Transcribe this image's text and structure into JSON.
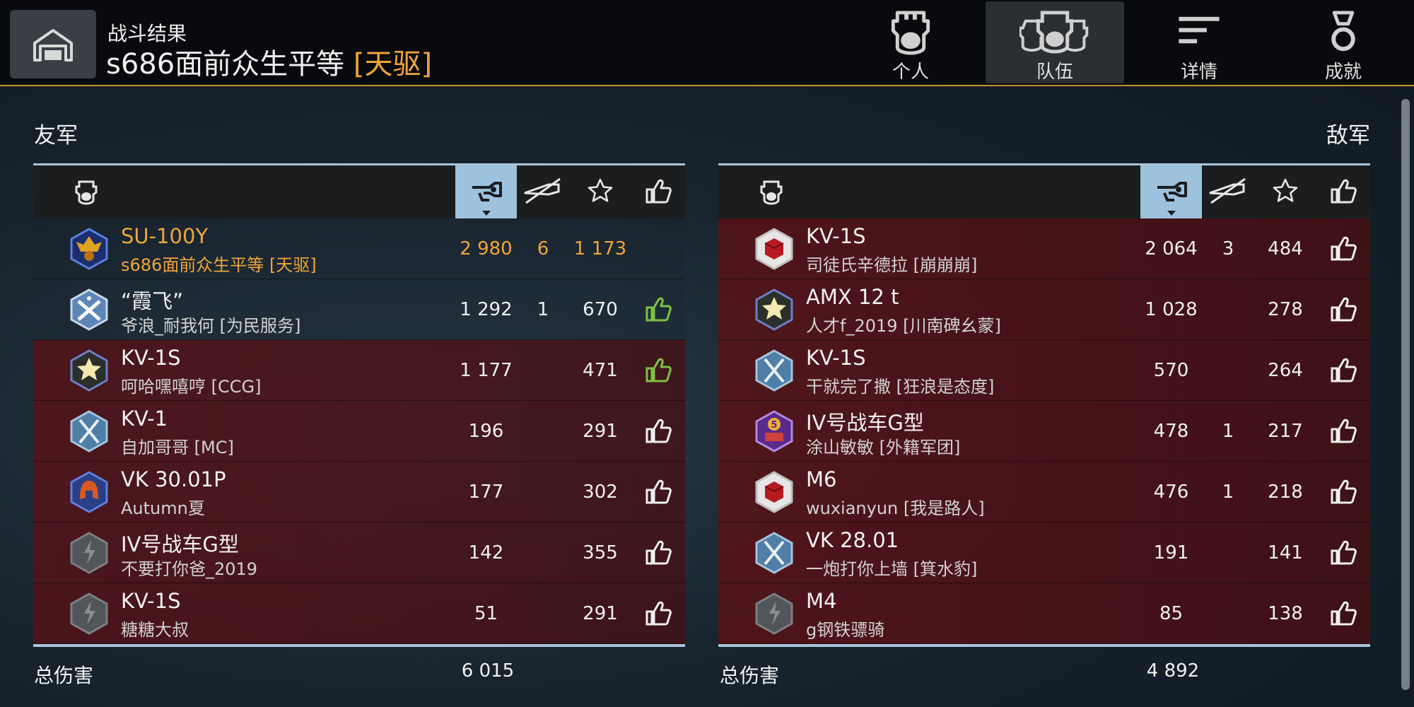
{
  "header": {
    "subtitle": "战斗结果",
    "player_name": "s686面前众生平等",
    "clan_tag": "[天驱]"
  },
  "tabs": [
    {
      "label": "个人",
      "icon": "personal-tank-icon",
      "active": false
    },
    {
      "label": "队伍",
      "icon": "team-icon",
      "active": true
    },
    {
      "label": "详情",
      "icon": "details-list-icon",
      "active": false
    },
    {
      "label": "成就",
      "icon": "medal-icon",
      "active": false
    }
  ],
  "allies": {
    "title": "友军",
    "sorted_column": "damage",
    "total_label": "总伤害",
    "total_damage": "6 015",
    "rows": [
      {
        "tank": "SU-100Y",
        "player": "s686面前众生平等 [天驱]",
        "damage": "2 980",
        "kills": "6",
        "xp": "1 173",
        "like": "none",
        "self": true,
        "alive": true,
        "badge": "gold-emblem-badge"
      },
      {
        "tank": "“霞飞”",
        "player": "爷浪_耐我何 [为民服务]",
        "damage": "1 292",
        "kills": "1",
        "xp": "670",
        "like": "green",
        "self": false,
        "alive": true,
        "badge": "crossed-guns-badge"
      },
      {
        "tank": "KV-1S",
        "player": "呵哈嘿嘻哼 [CCG]",
        "damage": "1 177",
        "kills": "",
        "xp": "471",
        "like": "green",
        "self": false,
        "alive": false,
        "badge": "star-badge"
      },
      {
        "tank": "KV-1",
        "player": "自加哥哥 [MC]",
        "damage": "196",
        "kills": "",
        "xp": "291",
        "like": "white",
        "self": false,
        "alive": false,
        "badge": "crossed-swords-badge"
      },
      {
        "tank": "VK 30.01P",
        "player": "Autumn夏",
        "damage": "177",
        "kills": "",
        "xp": "302",
        "like": "white",
        "self": false,
        "alive": false,
        "badge": "helmet-badge"
      },
      {
        "tank": "IV号战车G型",
        "player": "不要打你爸_2019",
        "damage": "142",
        "kills": "",
        "xp": "355",
        "like": "white",
        "self": false,
        "alive": false,
        "badge": "lightning-badge"
      },
      {
        "tank": "KV-1S",
        "player": "糖糖大叔",
        "damage": "51",
        "kills": "",
        "xp": "291",
        "like": "white",
        "self": false,
        "alive": false,
        "badge": "lightning-badge"
      }
    ]
  },
  "enemies": {
    "title": "敌军",
    "sorted_column": "damage",
    "total_label": "总伤害",
    "total_damage": "4 892",
    "rows": [
      {
        "tank": "KV-1S",
        "player": "司徒氏辛德拉 [崩崩崩]",
        "damage": "2 064",
        "kills": "3",
        "xp": "484",
        "like": "white",
        "badge": "red-cube-badge"
      },
      {
        "tank": "AMX 12 t",
        "player": "人才f_2019 [川南碑幺蒙]",
        "damage": "1 028",
        "kills": "",
        "xp": "278",
        "like": "white",
        "badge": "star-badge"
      },
      {
        "tank": "KV-1S",
        "player": "干就完了撒 [狂浪是态度]",
        "damage": "570",
        "kills": "",
        "xp": "264",
        "like": "white",
        "badge": "crossed-swords-badge"
      },
      {
        "tank": "IV号战车G型",
        "player": "涂山敏敏 [外籍军团]",
        "damage": "478",
        "kills": "1",
        "xp": "217",
        "like": "white",
        "badge": "five-cake-badge"
      },
      {
        "tank": "M6",
        "player": "wuxianyun [我是路人]",
        "damage": "476",
        "kills": "1",
        "xp": "218",
        "like": "white",
        "badge": "red-cube-badge"
      },
      {
        "tank": "VK 28.01",
        "player": "一炮打你上墙 [箕水豹]",
        "damage": "191",
        "kills": "",
        "xp": "141",
        "like": "white",
        "badge": "crossed-swords-badge"
      },
      {
        "tank": "M4",
        "player": "g钢铁骠骑",
        "damage": "85",
        "kills": "",
        "xp": "138",
        "like": "white",
        "badge": "lightning-badge"
      }
    ]
  },
  "colors": {
    "accent_orange": "#f0a53a",
    "like_green": "#7dc242",
    "sorted_header": "#9cc2de"
  }
}
